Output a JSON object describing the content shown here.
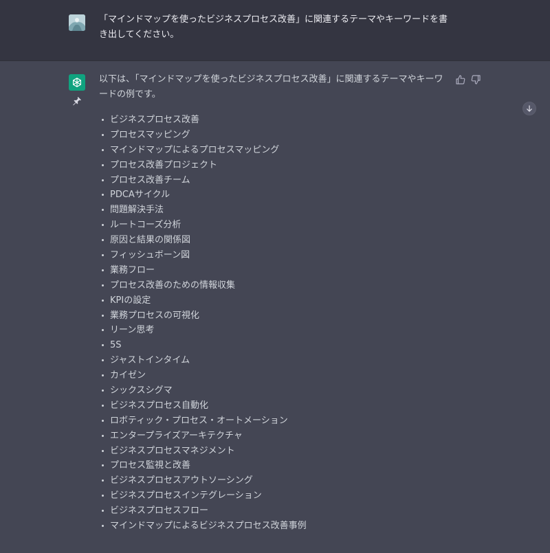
{
  "user_message": {
    "text": "「マインドマップを使ったビジネスプロセス改善」に関連するテーマやキーワードを書き出してください。",
    "avatar_icon": "user-avatar-image"
  },
  "assistant_message": {
    "intro": "以下は、「マインドマップを使ったビジネスプロセス改善」に関連するテーマやキーワードの例です。",
    "avatar_icon": "openai-logo-icon",
    "accent_color": "#10a37f",
    "items": [
      "ビジネスプロセス改善",
      "プロセスマッピング",
      "マインドマップによるプロセスマッピング",
      "プロセス改善プロジェクト",
      "プロセス改善チーム",
      "PDCAサイクル",
      "問題解決手法",
      "ルートコーズ分析",
      "原因と結果の関係図",
      "フィッシュボーン図",
      "業務フロー",
      "プロセス改善のための情報収集",
      "KPIの設定",
      "業務プロセスの可視化",
      "リーン思考",
      "5S",
      "ジャストインタイム",
      "カイゼン",
      "シックスシグマ",
      "ビジネスプロセス自動化",
      "ロボティック・プロセス・オートメーション",
      "エンタープライズアーキテクチャ",
      "ビジネスプロセスマネジメント",
      "プロセス監視と改善",
      "ビジネスプロセスアウトソーシング",
      "ビジネスプロセスインテグレーション",
      "ビジネスプロセスフロー",
      "マインドマップによるビジネスプロセス改善事例"
    ]
  },
  "colors": {
    "user_bg": "#343541",
    "assistant_bg": "#444654",
    "text_primary": "#ececf1",
    "text_secondary": "#d1d5db"
  }
}
